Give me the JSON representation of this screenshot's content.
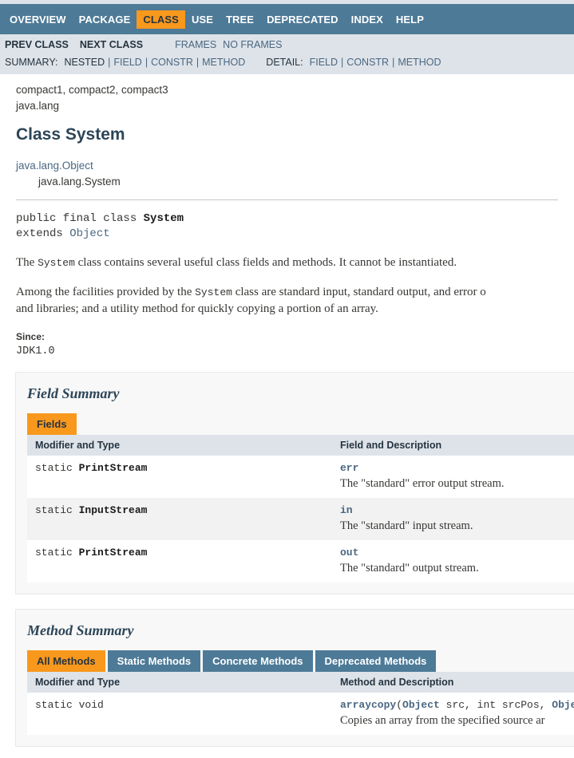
{
  "topnav": {
    "items": [
      {
        "label": "OVERVIEW",
        "active": false
      },
      {
        "label": "PACKAGE",
        "active": false
      },
      {
        "label": "CLASS",
        "active": true
      },
      {
        "label": "USE",
        "active": false
      },
      {
        "label": "TREE",
        "active": false
      },
      {
        "label": "DEPRECATED",
        "active": false
      },
      {
        "label": "INDEX",
        "active": false
      },
      {
        "label": "HELP",
        "active": false
      }
    ]
  },
  "subnav": {
    "prev_class": "PREV CLASS",
    "next_class": "NEXT CLASS",
    "frames": "FRAMES",
    "no_frames": "NO FRAMES",
    "summary_label": "SUMMARY:",
    "summary_items": [
      "NESTED",
      "FIELD",
      "CONSTR",
      "METHOD"
    ],
    "detail_label": "DETAIL:",
    "detail_items": [
      "FIELD",
      "CONSTR",
      "METHOD"
    ],
    "separator": "|"
  },
  "header": {
    "profiles": "compact1, compact2, compact3",
    "package": "java.lang",
    "title": "Class System"
  },
  "inheritance": {
    "parent": "java.lang.Object",
    "current": "java.lang.System"
  },
  "declaration": {
    "line1_prefix": "public final class ",
    "line1_name": "System",
    "line2_prefix": "extends ",
    "line2_type": "Object"
  },
  "description": {
    "para1_a": "The ",
    "para1_code": "System",
    "para1_b": " class contains several useful class fields and methods. It cannot be instantiated.",
    "para2_a": "Among the facilities provided by the ",
    "para2_code": "System",
    "para2_b": " class are standard input, standard output, and error o",
    "para2_line2": "and libraries; and a utility method for quickly copying a portion of an array.",
    "since_label": "Since:",
    "since_value": "JDK1.0"
  },
  "field_summary": {
    "title": "Field Summary",
    "tab": "Fields",
    "col1_header": "Modifier and Type",
    "col2_header": "Field and Description",
    "rows": [
      {
        "modifier": "static ",
        "type": "PrintStream",
        "name": "err",
        "description": "The \"standard\" error output stream."
      },
      {
        "modifier": "static ",
        "type": "InputStream",
        "name": "in",
        "description": "The \"standard\" input stream."
      },
      {
        "modifier": "static ",
        "type": "PrintStream",
        "name": "out",
        "description": "The \"standard\" output stream."
      }
    ]
  },
  "method_summary": {
    "title": "Method Summary",
    "tabs": [
      {
        "label": "All Methods",
        "active": true
      },
      {
        "label": "Static Methods",
        "active": false
      },
      {
        "label": "Concrete Methods",
        "active": false
      },
      {
        "label": "Deprecated Methods",
        "active": false
      }
    ],
    "col1_header": "Modifier and Type",
    "col2_header": "Method and Description",
    "rows": [
      {
        "modifier": "static void",
        "name": "arraycopy",
        "sig_open": "(",
        "sig_type1": "Object",
        "sig_arg1": " src, int srcPos, ",
        "sig_type2": "Obje",
        "description": "Copies an array from the specified source ar"
      }
    ]
  }
}
